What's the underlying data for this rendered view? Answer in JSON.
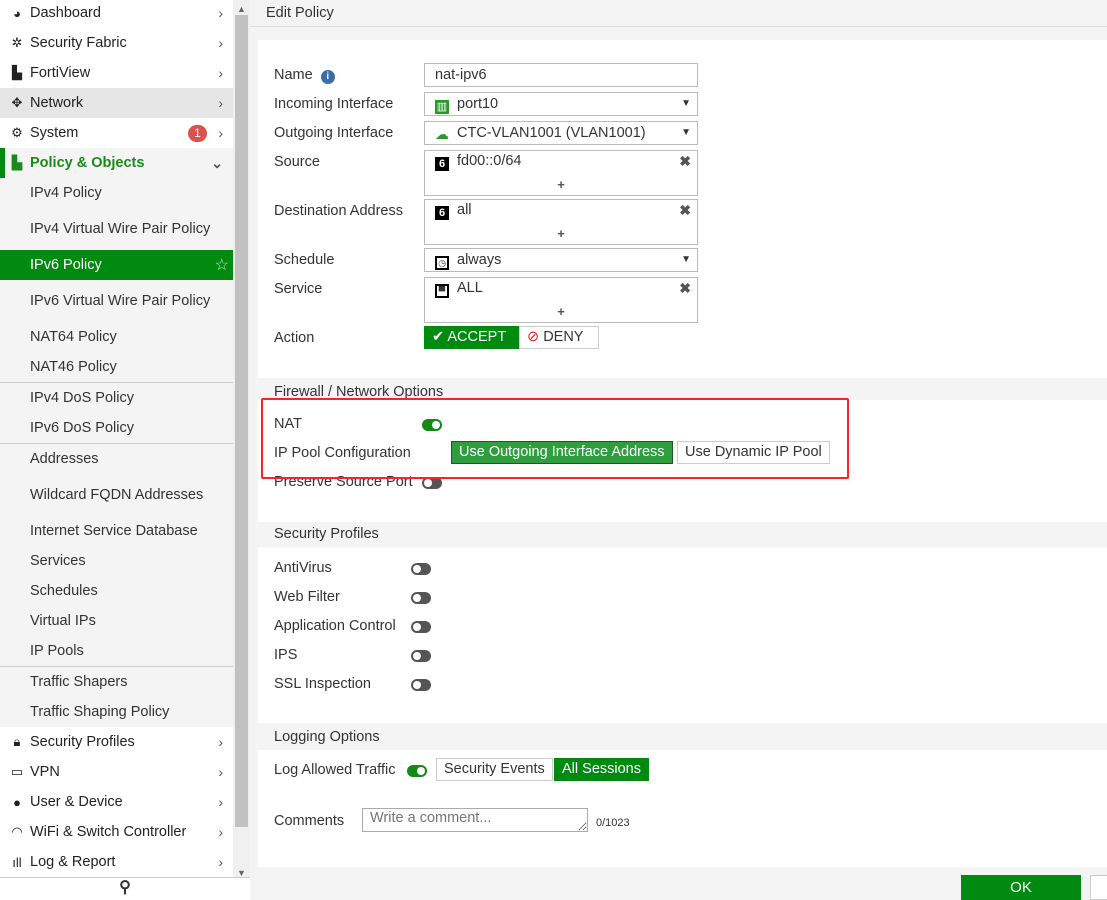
{
  "sidebar": {
    "top": [
      {
        "label": "Dashboard",
        "icon": "dashboard-icon"
      },
      {
        "label": "Security Fabric",
        "icon": "security-fabric-icon"
      },
      {
        "label": "FortiView",
        "icon": "fortiview-icon"
      },
      {
        "label": "Network",
        "icon": "network-icon"
      },
      {
        "label": "System",
        "icon": "gear-icon",
        "badge": "1"
      },
      {
        "label": "Policy & Objects",
        "icon": "policy-icon"
      }
    ],
    "sub": [
      "IPv4 Policy",
      "IPv4 Virtual Wire Pair Policy",
      "IPv6 Policy",
      "IPv6 Virtual Wire Pair Policy",
      "NAT64 Policy",
      "NAT46 Policy",
      "IPv4 DoS Policy",
      "IPv6 DoS Policy",
      "Addresses",
      "Wildcard FQDN Addresses",
      "Internet Service Database",
      "Services",
      "Schedules",
      "Virtual IPs",
      "IP Pools",
      "Traffic Shapers",
      "Traffic Shaping Policy"
    ],
    "bottom": [
      {
        "label": "Security Profiles",
        "icon": "lock-icon"
      },
      {
        "label": "VPN",
        "icon": "laptop-icon"
      },
      {
        "label": "User & Device",
        "icon": "user-icon"
      },
      {
        "label": "WiFi & Switch Controller",
        "icon": "wifi-icon"
      },
      {
        "label": "Log & Report",
        "icon": "bar-chart-icon"
      }
    ]
  },
  "header": {
    "title": "Edit Policy"
  },
  "form": {
    "name_label": "Name",
    "name_value": "nat-ipv6",
    "incoming_label": "Incoming Interface",
    "incoming_value": "port10",
    "outgoing_label": "Outgoing Interface",
    "outgoing_value": "CTC-VLAN1001 (VLAN1001)",
    "source_label": "Source",
    "source_value": "fd00::0/64",
    "dest_label": "Destination Address",
    "dest_value": "all",
    "schedule_label": "Schedule",
    "schedule_value": "always",
    "service_label": "Service",
    "service_value": "ALL",
    "action_label": "Action",
    "accept": "ACCEPT",
    "deny": "DENY",
    "action_selected": "ACCEPT",
    "plus": "+",
    "remove": "✖"
  },
  "firewall": {
    "title": "Firewall / Network Options",
    "nat_label": "NAT",
    "nat_on": true,
    "pool_label": "IP Pool Configuration",
    "pool_opt1": "Use Outgoing Interface Address",
    "pool_opt2": "Use Dynamic IP Pool",
    "pool_selected": "Use Outgoing Interface Address",
    "preserve_label": "Preserve Source Port",
    "preserve_on": false
  },
  "profiles": {
    "title": "Security Profiles",
    "items": [
      {
        "label": "AntiVirus",
        "on": false
      },
      {
        "label": "Web Filter",
        "on": false
      },
      {
        "label": "Application Control",
        "on": false
      },
      {
        "label": "IPS",
        "on": false
      },
      {
        "label": "SSL Inspection",
        "on": false
      }
    ]
  },
  "logging": {
    "title": "Logging Options",
    "log_label": "Log Allowed Traffic",
    "log_on": true,
    "opt1": "Security Events",
    "opt2": "All Sessions",
    "selected": "All Sessions",
    "comments_label": "Comments",
    "comments_placeholder": "Write a comment...",
    "counter": "0/1023"
  },
  "footer": {
    "ok": "OK"
  },
  "colors": {
    "accent": "#008a0f",
    "badge": "#d9534f",
    "highlight_box": "#ff2222"
  }
}
